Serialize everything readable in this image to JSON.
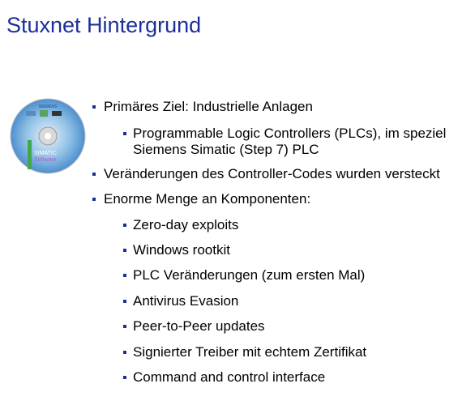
{
  "slide": {
    "title": "Stuxnet Hintergrund",
    "image": {
      "brand": "SIEMENS",
      "product": "SIMATIC",
      "sub": "Software"
    },
    "bullets": [
      {
        "level": 1,
        "lines": [
          "Primäres Ziel: Industrielle Anlagen"
        ]
      },
      {
        "level": 2,
        "lines": [
          "Programmable Logic Controllers (PLCs), im speziel",
          "Siemens Simatic (Step 7) PLC"
        ]
      },
      {
        "level": 1,
        "lines": [
          "Veränderungen des Controller-Codes wurden versteckt"
        ]
      },
      {
        "level": 1,
        "lines": [
          "Enorme Menge an Komponenten:"
        ]
      },
      {
        "level": 2,
        "lines": [
          "Zero-day exploits"
        ]
      },
      {
        "level": 2,
        "lines": [
          "Windows rootkit"
        ]
      },
      {
        "level": 2,
        "lines": [
          "PLC Veränderungen (zum ersten Mal)"
        ]
      },
      {
        "level": 2,
        "lines": [
          "Antivirus Evasion"
        ]
      },
      {
        "level": 2,
        "lines": [
          "Peer-to-Peer updates"
        ]
      },
      {
        "level": 2,
        "lines": [
          "Signierter Treiber mit echtem Zertifikat"
        ]
      },
      {
        "level": 2,
        "lines": [
          "Command and control interface"
        ]
      }
    ],
    "colors": {
      "title": "#1b2f9b",
      "bullet": "#1b2f9b"
    }
  }
}
